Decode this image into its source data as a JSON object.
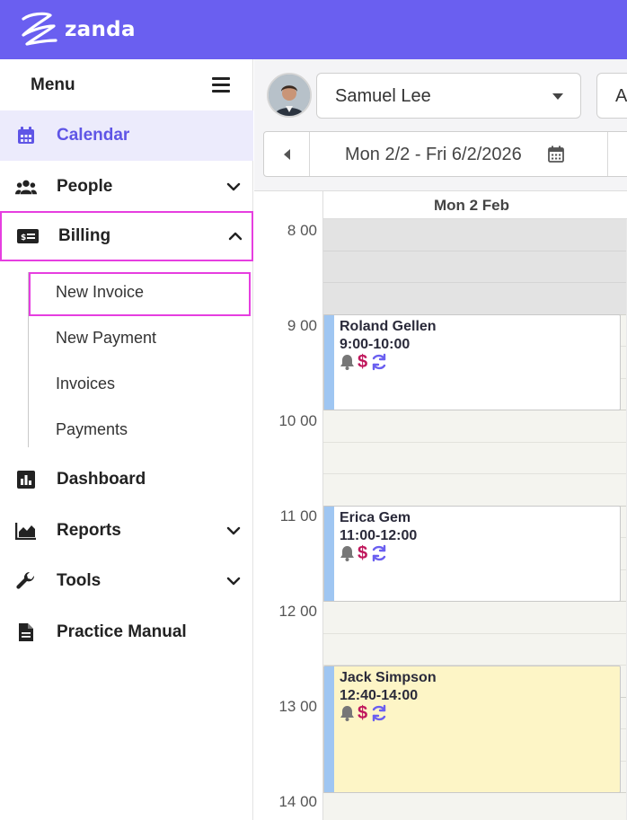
{
  "brand": {
    "name": "zanda",
    "color": "#6a5ff0"
  },
  "sidebar": {
    "menu_title": "Menu",
    "items": [
      {
        "label": "Calendar",
        "icon": "calendar-icon",
        "active": true
      },
      {
        "label": "People",
        "icon": "people-icon",
        "expandable": true
      },
      {
        "label": "Billing",
        "icon": "billing-icon",
        "expanded": true,
        "children": [
          "New Invoice",
          "New Payment",
          "Invoices",
          "Payments"
        ]
      },
      {
        "label": "Dashboard",
        "icon": "dashboard-icon"
      },
      {
        "label": "Reports",
        "icon": "reports-icon",
        "expandable": true
      },
      {
        "label": "Tools",
        "icon": "wrench-icon",
        "expandable": true
      },
      {
        "label": "Practice Manual",
        "icon": "document-icon"
      }
    ],
    "active_color": "#5f55e6",
    "highlight_color": "#e63ee0"
  },
  "toolbar": {
    "provider": "Samuel Lee",
    "other_select_partial": "A",
    "date_range": "Mon 2/2 - Fri 6/2/2026"
  },
  "calendar": {
    "day_header": "Mon 2 Feb",
    "hours": [
      "8 00",
      "9 00",
      "10 00",
      "11 00",
      "12 00",
      "13 00",
      "14 00"
    ],
    "appointments": [
      {
        "client": "Roland Gellen",
        "time": "9:00-10:00",
        "color": "#ffffff"
      },
      {
        "client": "Erica Gem",
        "time": "11:00-12:00",
        "color": "#ffffff"
      },
      {
        "client": "Jack Simpson",
        "time": "12:40-14:00",
        "color": "#fdf5c6"
      }
    ],
    "appointment_icons": [
      "bell-icon",
      "dollar-icon",
      "recurring-icon"
    ]
  }
}
